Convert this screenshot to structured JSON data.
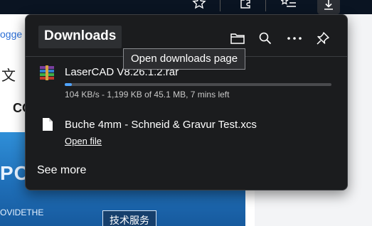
{
  "downloads": {
    "title": "Downloads",
    "tooltip": "Open downloads page",
    "actions": [
      {
        "name": "open-folder-button",
        "icon": "folder-icon"
      },
      {
        "name": "search-downloads-button",
        "icon": "search-icon"
      },
      {
        "name": "more-options-button",
        "icon": "ellipsis-icon"
      },
      {
        "name": "pin-button",
        "icon": "pin-icon"
      }
    ],
    "items": [
      {
        "filename": "LaserCAD V8.26.1.2.rar",
        "icon": "rar-archive-icon",
        "status": "104 KB/s - 1,199 KB of 45.1 MB, 7 mins left",
        "progress_fraction": 0.026
      },
      {
        "filename": "Buche 4mm - Schneid & Gravur Test.xcs",
        "icon": "file-icon",
        "action_label": "Open file"
      }
    ],
    "see_more": "See more"
  },
  "toolbar": {
    "icons": [
      "favorite-star-icon",
      "extensions-icon",
      "favorites-list-icon",
      "download-icon"
    ]
  },
  "background_page": {
    "link_fragment": "ogge",
    "glyph": "文",
    "heading_fragment": "CO",
    "banner_text": "POI",
    "banner_subtext": "OVIDETHE",
    "button_label": "技术服务"
  },
  "colors": {
    "flyout_bg": "#1b1c1e",
    "progress": "#4fa3ff",
    "toolbar_bg": "#0a1422",
    "banner": "#2f8fd8"
  }
}
